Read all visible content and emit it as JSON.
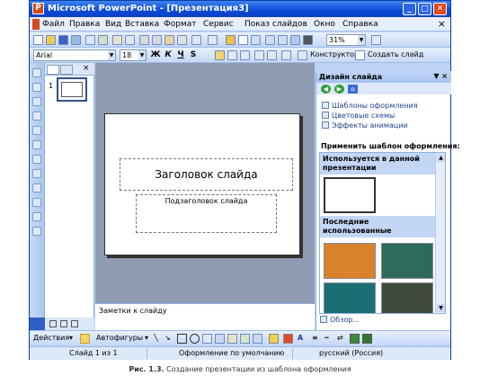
{
  "window": {
    "title": "Microsoft PowerPoint  - [Презентация3]"
  },
  "menu": [
    "Файл",
    "Правка",
    "Вид",
    "Вставка",
    "Формат",
    "Сервис",
    "Показ слайдов",
    "Окно",
    "Справка"
  ],
  "toolbar": {
    "zoom": "31%",
    "font": "Arial",
    "size": "18",
    "bold": "Ж",
    "italic": "К",
    "underline": "Ч",
    "shadow": "S",
    "designer": "Конструктор",
    "new_slide": "Создать слайд"
  },
  "thumbnails": {
    "slide_number": "1"
  },
  "slide": {
    "title_placeholder": "Заголовок слайда",
    "subtitle_placeholder": "Подзаголовок слайда"
  },
  "notes": {
    "placeholder": "Заметки к слайду"
  },
  "taskpane": {
    "title": "Дизайн слайда",
    "links": [
      "Шаблоны оформления",
      "Цветовые схемы",
      "Эффекты анимации"
    ],
    "apply_label": "Применить шаблон оформления:",
    "section_current": "Используется в данной презентации",
    "section_recent": "Последние использованные",
    "browse": "Обзор..."
  },
  "drawing": {
    "actions": "Действия",
    "autoshapes": "Автофигуры"
  },
  "status": {
    "slide": "Слайд 1 из 1",
    "design": "Оформление по умолчанию",
    "language": "русский (Россия)"
  },
  "caption": {
    "label": "Рис. 1.3.",
    "text": "Создание презентации из шаблона оформления"
  },
  "colors": {
    "title_bar": "#0a49d8",
    "accent": "#d24b1c",
    "slide_area": "#8e9bb0"
  }
}
